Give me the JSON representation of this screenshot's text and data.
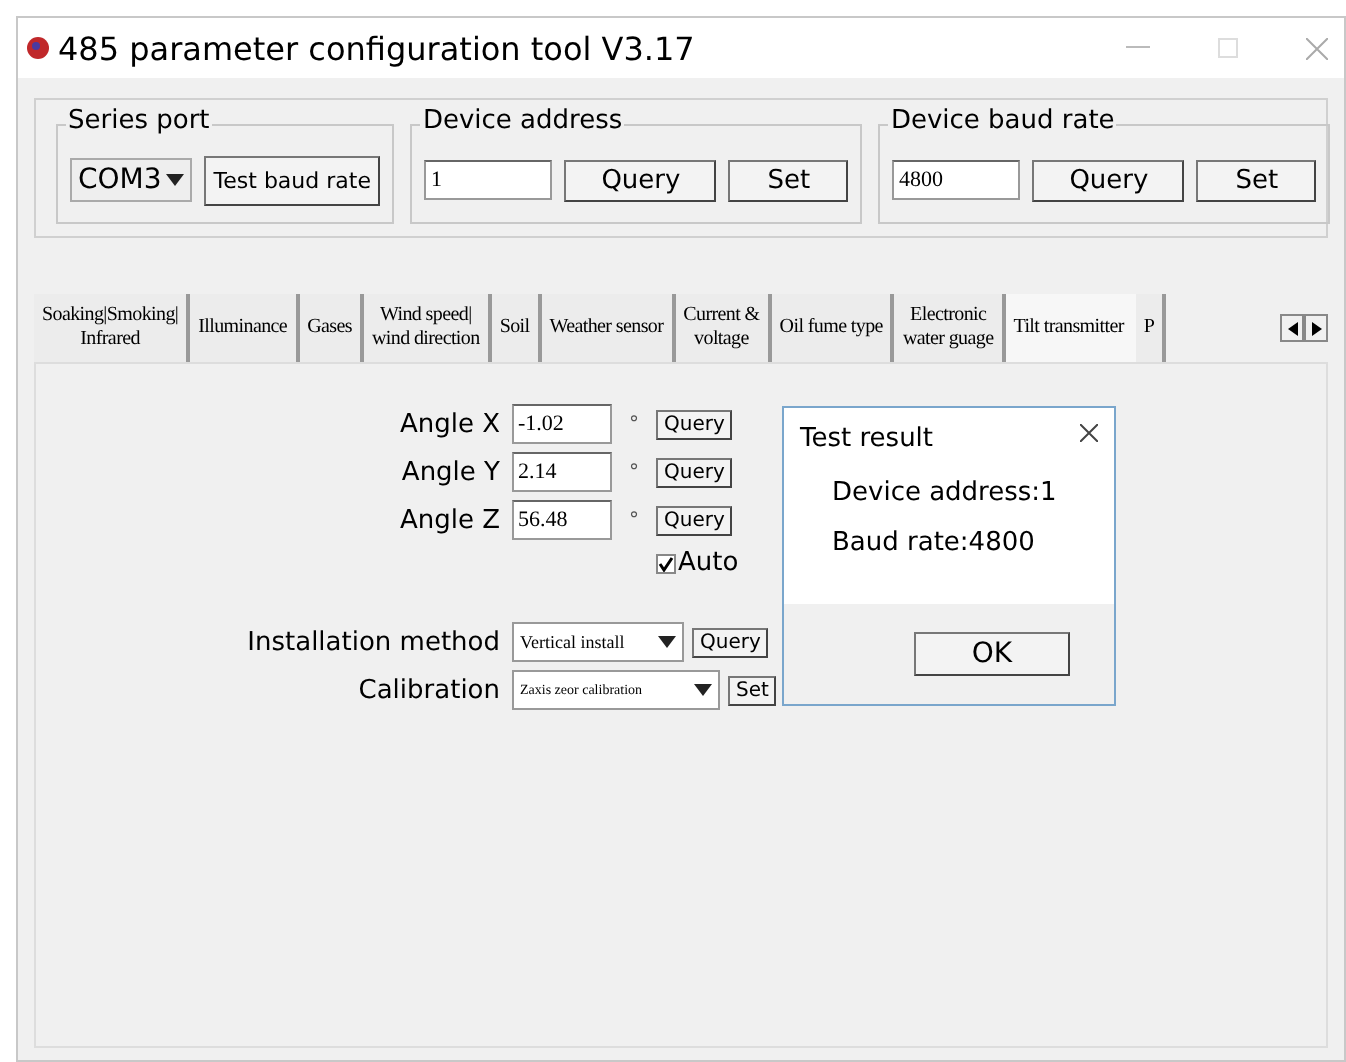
{
  "window": {
    "title": "485 parameter configuration tool V3.17"
  },
  "groups": [
    {
      "kind": "port",
      "title": "Series port",
      "combo": "COM3",
      "button": "Test baud rate"
    },
    {
      "kind": "field",
      "title": "Device address",
      "value": "1",
      "buttons": [
        "Query",
        "Set"
      ]
    },
    {
      "kind": "field",
      "title": "Device baud rate",
      "value": "4800",
      "buttons": [
        "Query",
        "Set"
      ]
    }
  ],
  "tabs": [
    {
      "label": "Soaking|Smoking|\nInfrared",
      "selected": false
    },
    {
      "label": "Illuminance",
      "selected": false
    },
    {
      "label": "Gases",
      "selected": false
    },
    {
      "label": "Wind speed|\nwind direction",
      "selected": false
    },
    {
      "label": "Soil",
      "selected": false
    },
    {
      "label": "Weather sensor",
      "selected": false
    },
    {
      "label": "Current &\nvoltage",
      "selected": false
    },
    {
      "label": "Oil fume type",
      "selected": false
    },
    {
      "label": "Electronic\nwater guage",
      "selected": false
    },
    {
      "label": "Tilt transmitter",
      "selected": true
    },
    {
      "label": "P",
      "selected": false
    }
  ],
  "angles": [
    {
      "label": "Angle X",
      "value": "-1.02",
      "unit": "°",
      "button": "Query"
    },
    {
      "label": "Angle Y",
      "value": "2.14",
      "unit": "°",
      "button": "Query"
    },
    {
      "label": "Angle Z",
      "value": "56.48",
      "unit": "°",
      "button": "Query"
    }
  ],
  "auto": {
    "label": "Auto",
    "checked": true
  },
  "selects": [
    {
      "label": "Installation method",
      "value": "Vertical install",
      "button": "Query"
    },
    {
      "label": "Calibration",
      "value": "Zaxis zeor calibration",
      "button": "Set"
    }
  ],
  "dialog": {
    "title": "Test result",
    "lines": [
      "Device address:1",
      "Baud rate:4800"
    ],
    "button": "OK"
  }
}
